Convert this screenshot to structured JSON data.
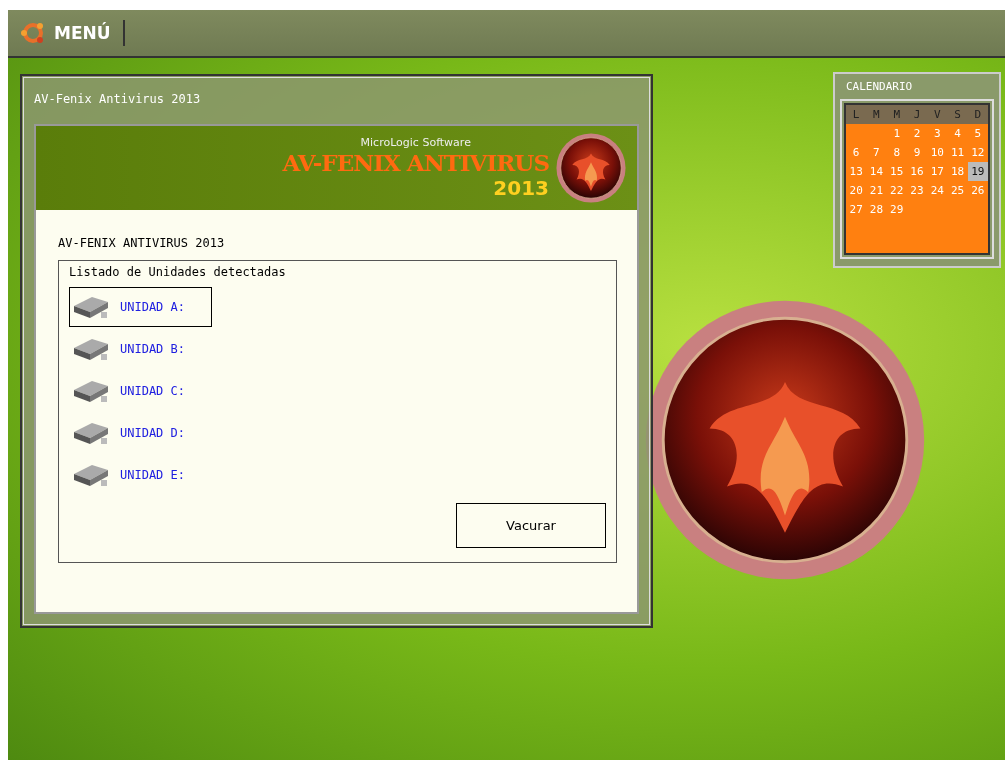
{
  "menu": {
    "label": "MENÚ"
  },
  "window": {
    "title": "AV-Fenix Antivirus 2013"
  },
  "banner": {
    "company": "MicroLogic Software",
    "product": "AV-FENIX ANTIVIRUS",
    "year": "2013"
  },
  "app": {
    "heading": "AV-FENIX ANTIVIRUS 2013",
    "group_title": "Listado de Unidades detectadas",
    "drives": [
      {
        "label": "UNIDAD A:",
        "selected": true
      },
      {
        "label": "UNIDAD B:",
        "selected": false
      },
      {
        "label": "UNIDAD C:",
        "selected": false
      },
      {
        "label": "UNIDAD D:",
        "selected": false
      },
      {
        "label": "UNIDAD E:",
        "selected": false
      }
    ],
    "button": "Vacurar"
  },
  "calendar": {
    "title": "CALENDARIO",
    "weekdays": [
      "L",
      "M",
      "M",
      "J",
      "V",
      "S",
      "D"
    ],
    "days": [
      {
        "label": "1",
        "selected": false
      },
      {
        "label": "2",
        "selected": false
      },
      {
        "label": "3",
        "selected": false
      },
      {
        "label": "4",
        "selected": false
      },
      {
        "label": "5",
        "selected": false
      },
      {
        "label": "6",
        "selected": false
      },
      {
        "label": "7",
        "selected": false
      },
      {
        "label": "8",
        "selected": false
      },
      {
        "label": "9",
        "selected": false
      },
      {
        "label": "10",
        "selected": false
      },
      {
        "label": "11",
        "selected": false
      },
      {
        "label": "12",
        "selected": false
      },
      {
        "label": "13",
        "selected": false
      },
      {
        "label": "14",
        "selected": false
      },
      {
        "label": "15",
        "selected": false
      },
      {
        "label": "16",
        "selected": false
      },
      {
        "label": "17",
        "selected": false
      },
      {
        "label": "18",
        "selected": false
      },
      {
        "label": "19",
        "selected": true
      },
      {
        "label": "20",
        "selected": false
      },
      {
        "label": "21",
        "selected": false
      },
      {
        "label": "22",
        "selected": false
      },
      {
        "label": "23",
        "selected": false
      },
      {
        "label": "24",
        "selected": false
      },
      {
        "label": "25",
        "selected": false
      },
      {
        "label": "26",
        "selected": false
      },
      {
        "label": "27",
        "selected": false
      },
      {
        "label": "28",
        "selected": false
      },
      {
        "label": "29",
        "selected": false
      }
    ]
  }
}
